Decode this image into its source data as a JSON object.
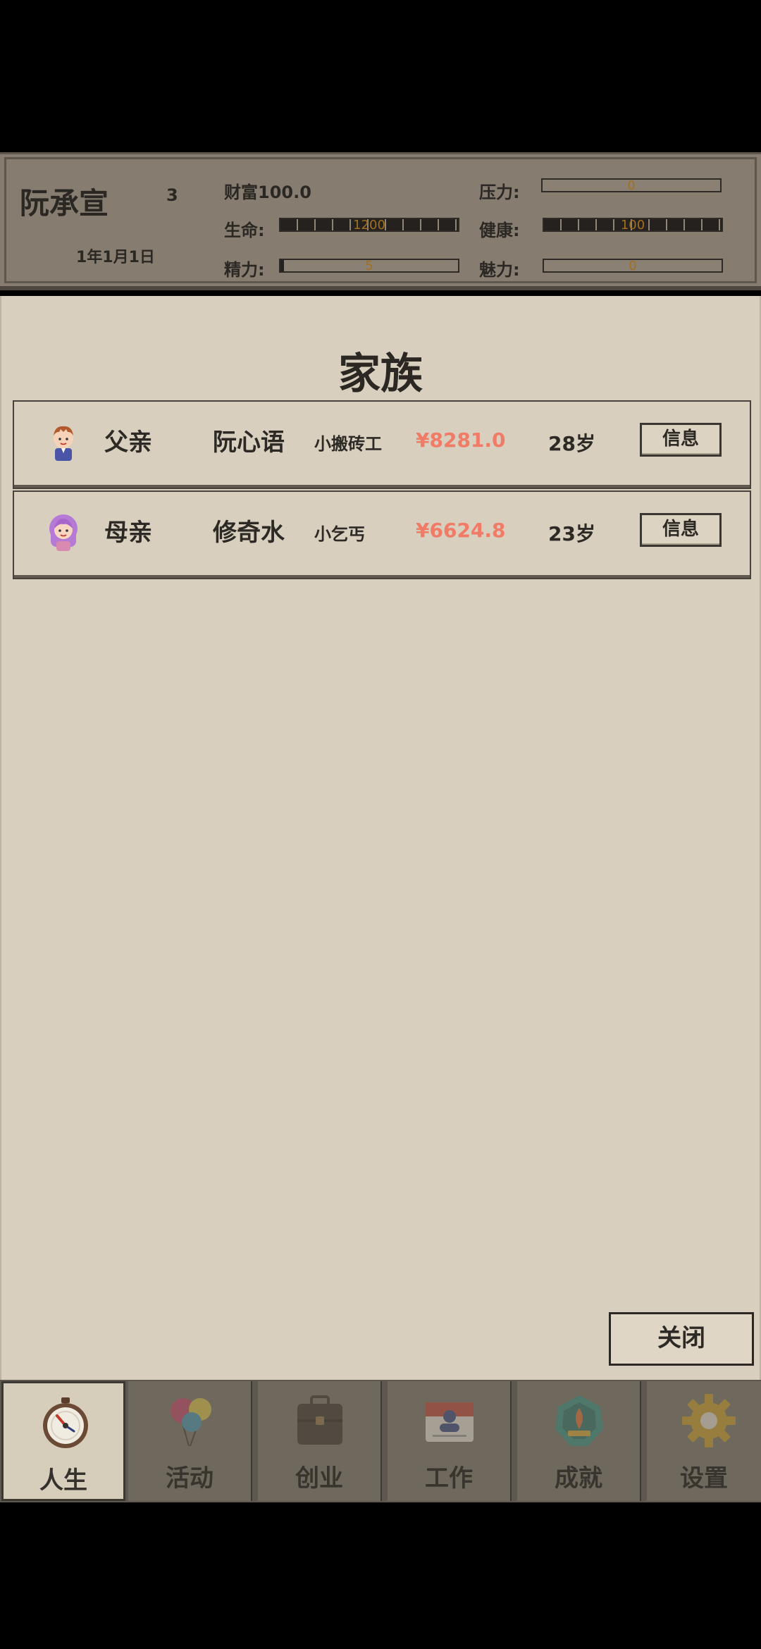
{
  "player": {
    "name": "阮承宣",
    "level": "3",
    "date": "1年1月1日",
    "wealth_label": "财富100.0"
  },
  "stats": {
    "pressure": {
      "label": "压力:",
      "value": "0",
      "fraction": 0.0
    },
    "life": {
      "label": "生命:",
      "value": "1200",
      "fraction": 1.0
    },
    "health": {
      "label": "健康:",
      "value": "100",
      "fraction": 1.0
    },
    "energy": {
      "label": "精力:",
      "value": "5",
      "fraction": 0.02
    },
    "charm": {
      "label": "魅力:",
      "value": "0",
      "fraction": 0.0
    }
  },
  "panel": {
    "title": "家族",
    "members": [
      {
        "relation": "父亲",
        "name": "阮心语",
        "job": "小搬砖工",
        "money": "¥8281.0",
        "age": "28岁",
        "info_label": "信息",
        "avatar": "father-avatar-icon"
      },
      {
        "relation": "母亲",
        "name": "修奇水",
        "job": "小乞丐",
        "money": "¥6624.8",
        "age": "23岁",
        "info_label": "信息",
        "avatar": "mother-avatar-icon"
      }
    ],
    "close_label": "关闭"
  },
  "nav": {
    "tabs": [
      {
        "label": "人生",
        "icon": "stopwatch-icon",
        "active": true
      },
      {
        "label": "活动",
        "icon": "balloons-icon",
        "active": false
      },
      {
        "label": "创业",
        "icon": "briefcase-icon",
        "active": false
      },
      {
        "label": "工作",
        "icon": "id-card-icon",
        "active": false
      },
      {
        "label": "成就",
        "icon": "badge-icon",
        "active": false
      },
      {
        "label": "设置",
        "icon": "gear-icon",
        "active": false
      }
    ]
  },
  "colors": {
    "panel_bg": "#d9cfbe",
    "header_bg": "#867d70",
    "money": "#f07b66",
    "nav_bg": "#5e5850"
  }
}
